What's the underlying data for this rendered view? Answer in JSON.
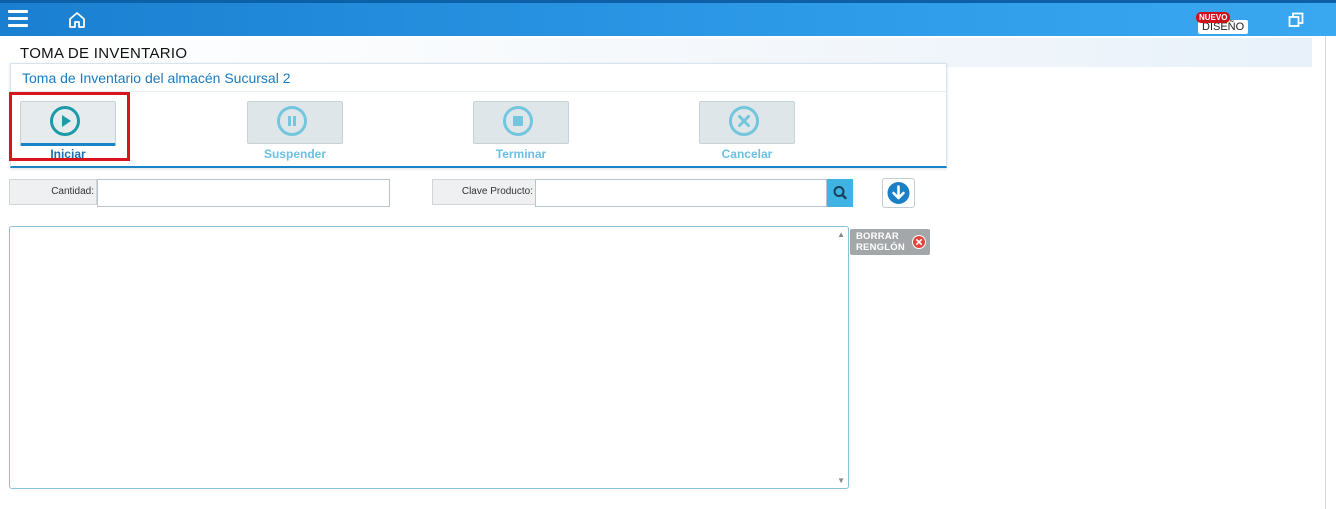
{
  "header": {
    "menu_icon": "hamburger-icon",
    "home_icon": "home-icon",
    "badge_new": "NUEVO",
    "design_label": "DISEÑO",
    "restore_icon": "restore-window-icon",
    "colors": {
      "bar": "#2a92e0",
      "badge": "#d0101a"
    }
  },
  "page": {
    "title": "TOMA DE INVENTARIO"
  },
  "panel": {
    "title": "Toma de Inventario del almacén Sucursal 2",
    "actions": [
      {
        "label": "Iniciar",
        "icon": "play-icon",
        "enabled": true,
        "highlighted": true
      },
      {
        "label": "Suspender",
        "icon": "pause-icon",
        "enabled": false
      },
      {
        "label": "Terminar",
        "icon": "stop-icon",
        "enabled": false
      },
      {
        "label": "Cancelar",
        "icon": "cancel-x-icon",
        "enabled": false
      }
    ]
  },
  "form": {
    "cantidad_label": "Cantidad:",
    "cantidad_value": "",
    "clave_label": "Clave Producto:",
    "clave_value": "",
    "search_icon": "search-icon",
    "add_icon": "arrow-down-circle-icon"
  },
  "list": {
    "content": ""
  },
  "borrar": {
    "line1": "BORRAR",
    "line2": "RENGLÓN",
    "icon": "close-circle-icon"
  }
}
